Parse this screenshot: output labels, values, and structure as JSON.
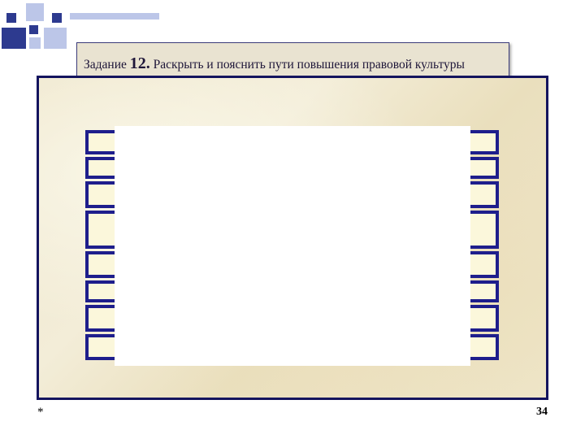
{
  "title": {
    "prefix": "Задание ",
    "number": "12.",
    "rest": " Раскрыть и пояснить пути  повышения правовой культуры"
  },
  "footer": {
    "left": "*",
    "page": "34"
  },
  "bars": [
    {
      "label": ""
    },
    {
      "label": ""
    },
    {
      "label": ""
    },
    {
      "label": ""
    },
    {
      "label": ""
    },
    {
      "label": ""
    },
    {
      "label": ""
    },
    {
      "label": ""
    }
  ]
}
